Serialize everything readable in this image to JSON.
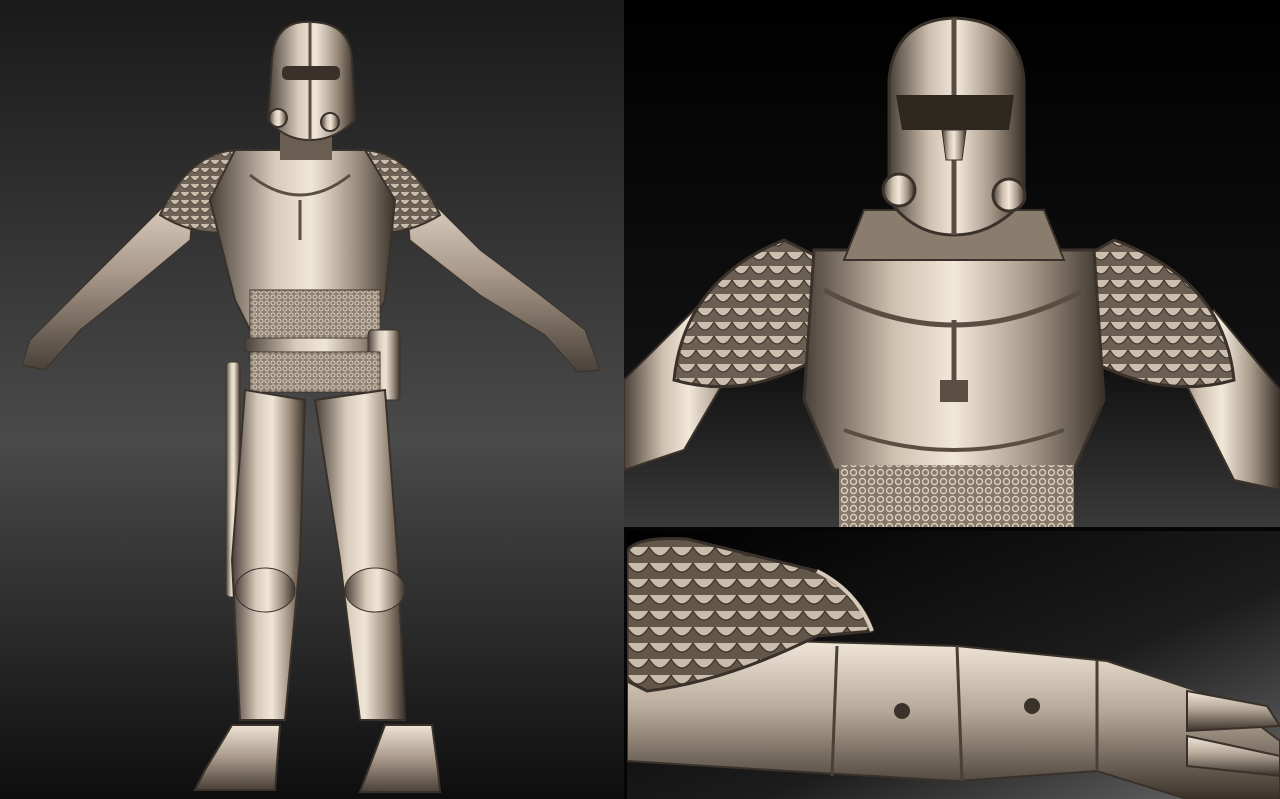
{
  "image": {
    "description_free": true,
    "panels": [
      {
        "id": "full-body-view",
        "subject": "armored-figure-full-body"
      },
      {
        "id": "torso-closeup",
        "subject": "helmet-and-chest-armor"
      },
      {
        "id": "arm-closeup",
        "subject": "shoulder-and-gauntlet-armor"
      }
    ],
    "colors": {
      "background_top": "#5a5a5a",
      "background_bottom": "#0a0a0a",
      "metal_light": "#e8dccd",
      "metal_mid": "#a89a8a",
      "metal_dark": "#3d352d"
    }
  }
}
